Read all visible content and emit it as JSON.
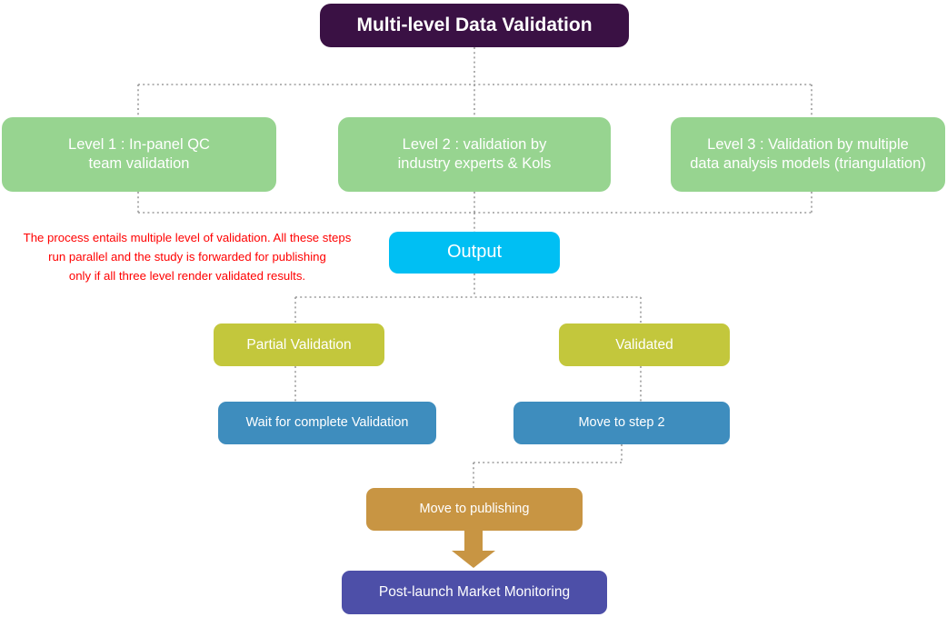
{
  "diagram": {
    "title": "Multi-level Data Validation",
    "annotation": "The process entails multiple level of validation. All these steps\nrun parallel and the study is forwarded for publishing\nonly if all three level render validated results.",
    "levels": [
      {
        "label": "Level 1 : In-panel QC\nteam validation"
      },
      {
        "label": "Level 2 : validation by\nindustry experts & Kols"
      },
      {
        "label": "Level 3 : Validation by multiple\ndata analysis models (triangulation)"
      }
    ],
    "output": {
      "label": "Output"
    },
    "branches": [
      {
        "label": "Partial Validation"
      },
      {
        "label": "Validated"
      }
    ],
    "actions": [
      {
        "label": "Wait for complete Validation"
      },
      {
        "label": "Move to step 2"
      }
    ],
    "publishing": {
      "label": "Move to publishing"
    },
    "postlaunch": {
      "label": "Post-launch Market Monitoring"
    },
    "colors": {
      "title_purple": "#3A1144",
      "level_green": "#97D490",
      "output_cyan": "#00BFF3",
      "branch_olive": "#C3C73C",
      "action_blue": "#3E8DBE",
      "publishing_gold": "#C89543",
      "postlaunch_purple": "#4D4FA8",
      "annotation_red": "#FF0000",
      "connector_gray": "#9B9B9B"
    }
  }
}
